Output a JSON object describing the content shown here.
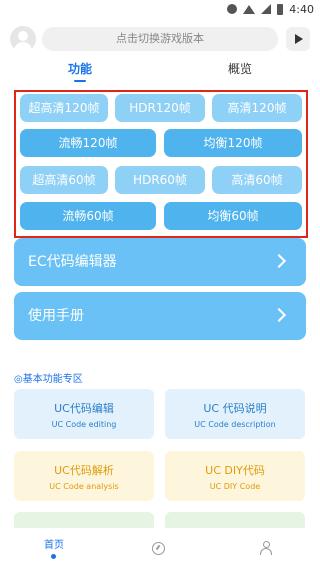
{
  "status": {
    "time": "4:40"
  },
  "header": {
    "search_placeholder": "点击切换游戏版本"
  },
  "tabs": [
    {
      "label": "功能"
    },
    {
      "label": "概览"
    }
  ],
  "presets": {
    "row1": [
      "超高清120帧",
      "HDR120帧",
      "高清120帧"
    ],
    "row2": [
      "流畅120帧",
      "均衡120帧"
    ],
    "row3": [
      "超高清60帧",
      "HDR60帧",
      "高清60帧"
    ],
    "row4": [
      "流畅60帧",
      "均衡60帧"
    ]
  },
  "menu": {
    "editor": "EC代码编辑器",
    "manual": "使用手册"
  },
  "section": {
    "title": "◎基本功能专区"
  },
  "cards": [
    {
      "title": "UC代码编辑",
      "subtitle": "UC Code editing"
    },
    {
      "title": "UC 代码说明",
      "subtitle": "UC Code description"
    },
    {
      "title": "UC代码解析",
      "subtitle": "UC Code analysis"
    },
    {
      "title": "UC DIY代码",
      "subtitle": "UC DIY Code"
    }
  ],
  "nav": {
    "home": "首页"
  },
  "colors": {
    "accent": "#1a73e8",
    "preset_light": "#8ed0f6",
    "preset_dark": "#4fb3ee",
    "highlight_border": "#e0261b"
  }
}
